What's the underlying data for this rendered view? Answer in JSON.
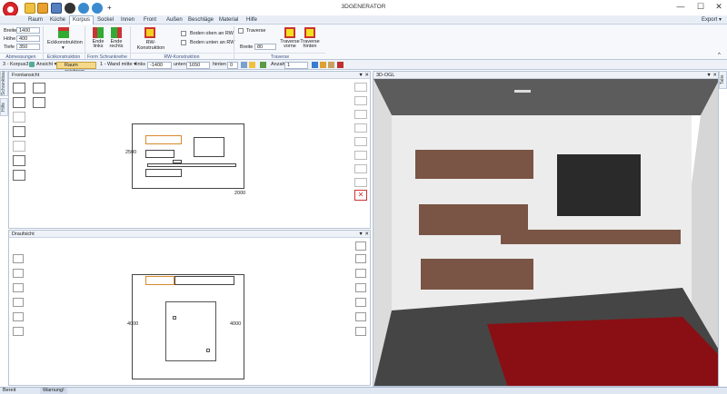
{
  "app": {
    "title": "3DGENERATOR",
    "export_label": "Export"
  },
  "window_buttons": {
    "minimize": "—",
    "maximize": "☐",
    "close": "✕"
  },
  "tabs": [
    "Raum",
    "Küche",
    "Korpus",
    "Sockel",
    "Innen",
    "Front",
    "Außen",
    "Beschläge",
    "Material",
    "Hilfe"
  ],
  "active_tab": "Korpus",
  "ribbon": {
    "dimensions": {
      "breite_label": "Breite",
      "breite_value": "1400",
      "hoehe_label": "Höhe",
      "hoehe_value": "400",
      "tiefe_label": "Tiefe",
      "tiefe_value": "350",
      "group": "Abmessungen"
    },
    "eckkonstruktion": {
      "label": "Eckkonstruktion",
      "group": "Eckkonstruktion"
    },
    "ende_links": {
      "label": "Ende\nlinks"
    },
    "ende_rechts": {
      "label": "Ende\nrechts"
    },
    "form_group": "Form Schrankreihe",
    "rw_konstruktion": {
      "label": "RW-Konstruktion",
      "group": "RW-Konstruktion"
    },
    "boden_oben": "Boden oben an RW",
    "boden_unten": "Boden unten an RW",
    "traverse": {
      "checkbox_label": "Traverse",
      "breite_label": "Breite",
      "breite_value": "80",
      "group": "Traverse"
    },
    "traverse_vorne": "Traverse\nvorne",
    "traverse_hinten": "Traverse\nhinten"
  },
  "toolbar": {
    "korpus_select": "3 - Korpus3",
    "ansicht": "Ansicht",
    "raum_zeichnen": "Raum zeichnen",
    "wand_select": "1 - Wand mitte",
    "links_label": "links",
    "links_value": "-1400",
    "unten_label": "unten",
    "unten_value": "1650",
    "hinten_label": "hinten",
    "hinten_value": "0",
    "anzahl_label": "Anzahl",
    "anzahl_value": "1"
  },
  "panels": {
    "frontansicht": {
      "title": "Frontansicht",
      "dim_height": "2500",
      "dim_width": "2000"
    },
    "draufsicht": {
      "title": "Draufsicht",
      "dim_left": "4000",
      "dim_right": "4000"
    },
    "ogl": {
      "title": "3D-OGL"
    }
  },
  "side_tabs": {
    "left_top": "Schrankbau",
    "left_bottom": "Hilfe",
    "right": "Tabs"
  },
  "status": {
    "ready": "Bereit",
    "warning": "Warnung!"
  },
  "colors": {
    "cabinet": "#7a5545",
    "carpet": "#8a0f14",
    "wall": "#e9e9e9",
    "floor": "#3f3f3f",
    "tv": "#2a2a2a",
    "highlight": "#d98a2b"
  }
}
